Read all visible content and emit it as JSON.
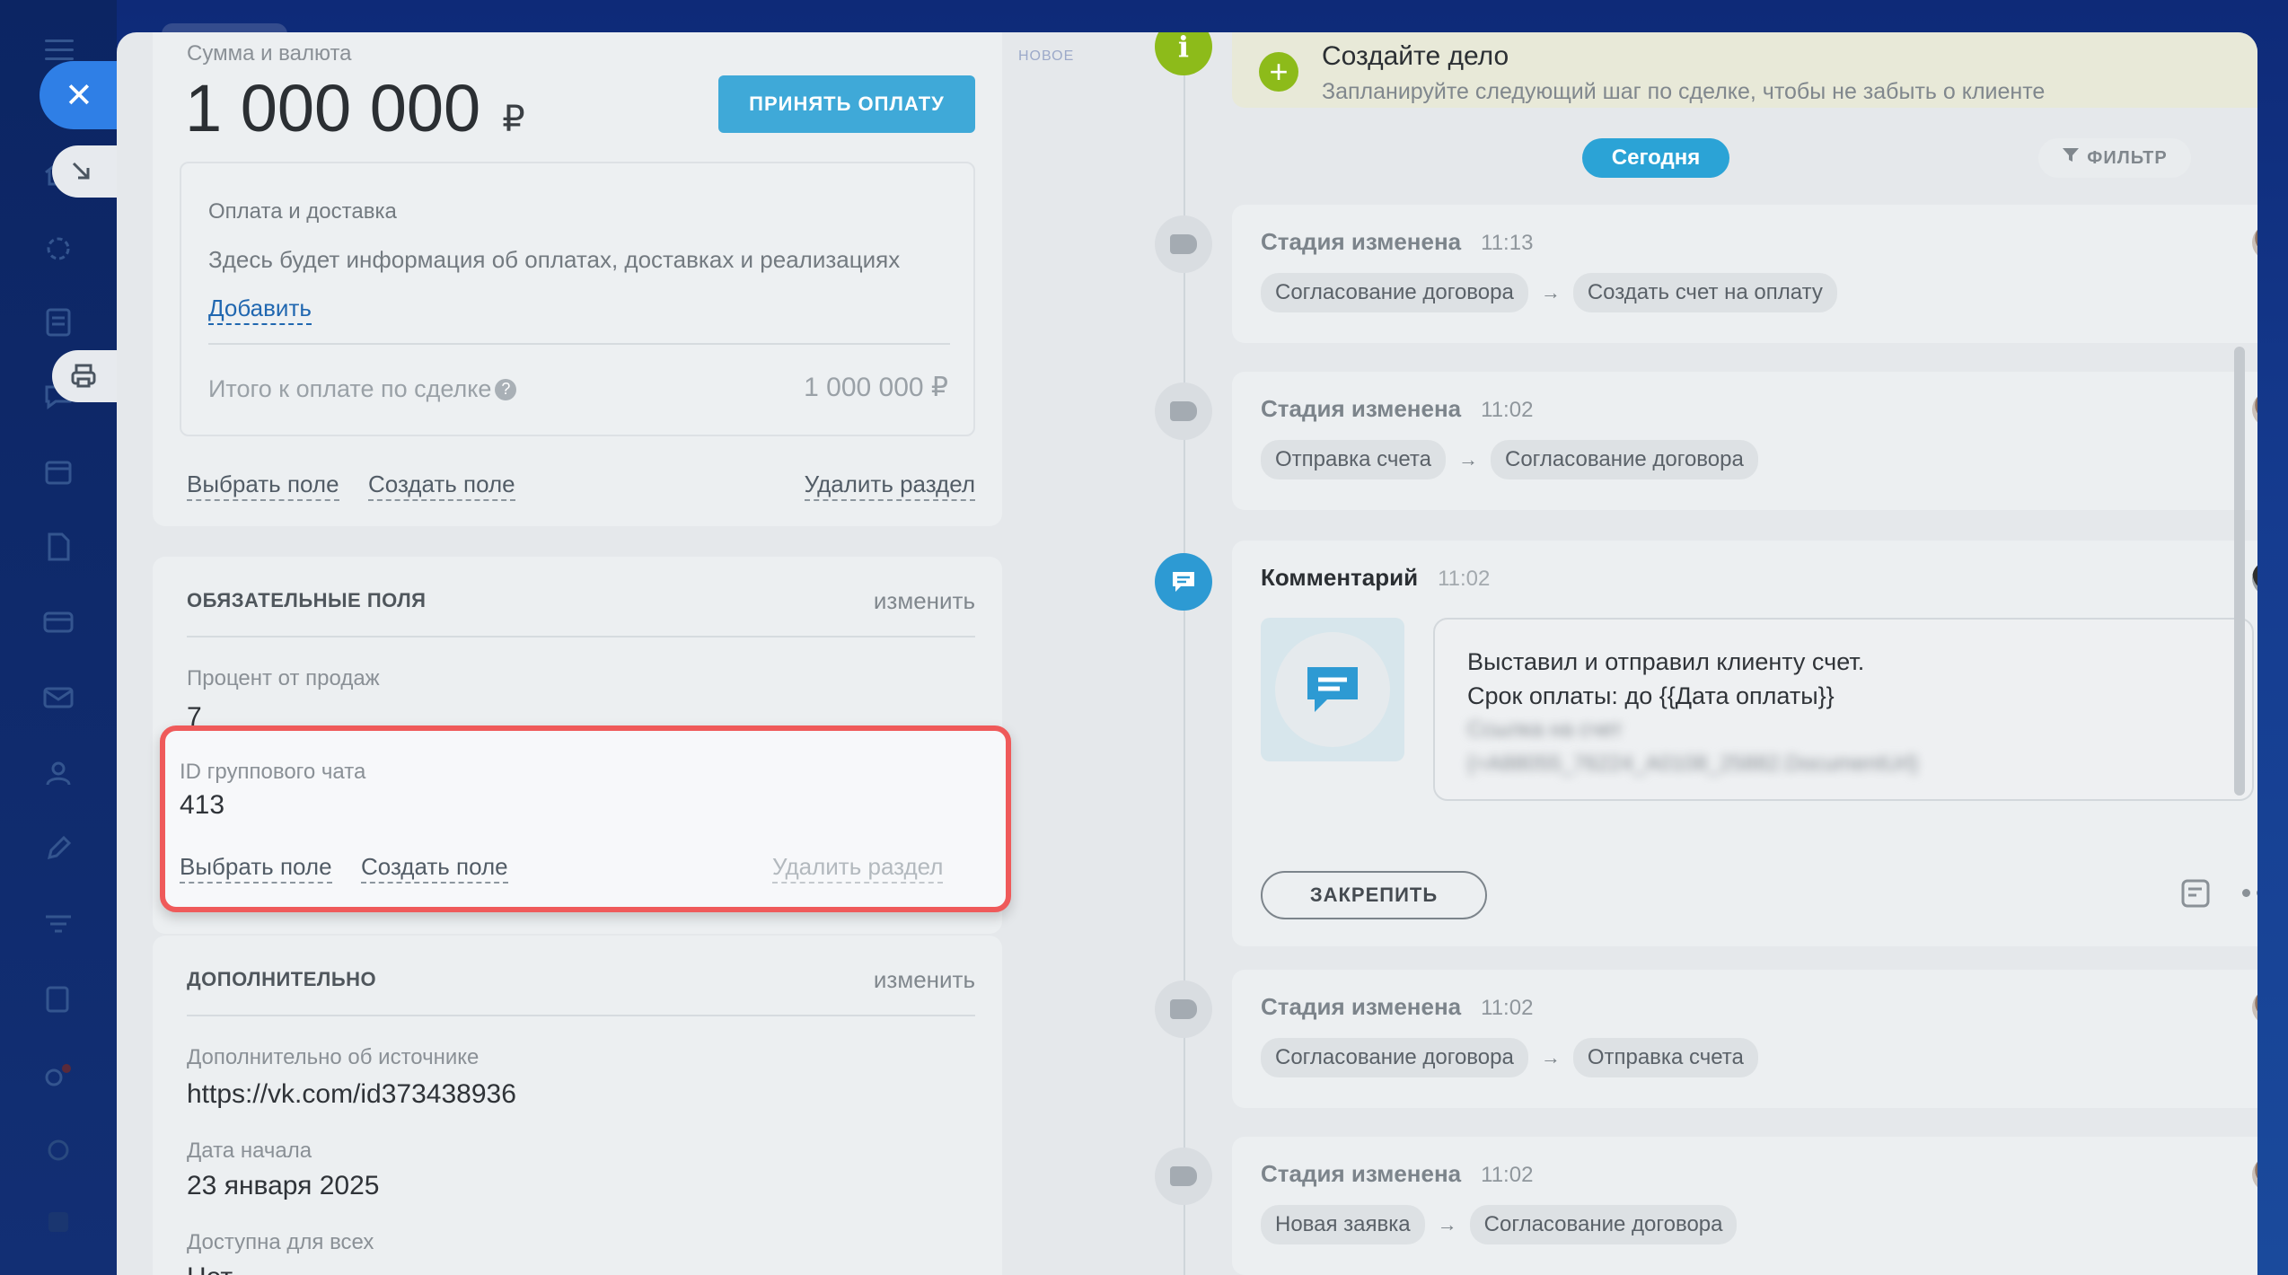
{
  "header": {
    "new_label": "НОВОЕ"
  },
  "payment": {
    "amount_label": "Сумма и валюта",
    "amount": "1 000 000",
    "currency": "₽",
    "accept_button": "ПРИНЯТЬ ОПЛАТУ",
    "delivery_title": "Оплата и доставка",
    "delivery_hint": "Здесь будет информация об оплатах, доставках и реализациях",
    "add_link": "Добавить",
    "total_label": "Итого к оплате по сделке",
    "total_value": "1 000 000 ₽",
    "select_field": "Выбрать поле",
    "create_field": "Создать поле",
    "delete_section": "Удалить раздел"
  },
  "required": {
    "title": "ОБЯЗАТЕЛЬНЫЕ ПОЛЯ",
    "edit": "изменить",
    "sales_percent_label": "Процент от продаж",
    "sales_percent_value": "7"
  },
  "group_chat": {
    "label": "ID группового чата",
    "value": "413",
    "select_field": "Выбрать поле",
    "create_field": "Создать поле",
    "delete_section": "Удалить раздел"
  },
  "additional": {
    "title": "ДОПОЛНИТЕЛЬНО",
    "edit": "изменить",
    "source_label": "Дополнительно об источнике",
    "source_value": "https://vk.com/id373438936",
    "start_label": "Дата начала",
    "start_value": "23 января 2025",
    "access_label": "Доступна для всех",
    "access_value": "Нет"
  },
  "timeline": {
    "todo_title": "Создайте дело",
    "todo_hint": "Запланируйте следующий шаг по сделке, чтобы не забыть о клиенте",
    "today": "Сегодня",
    "filter": "ФИЛЬТР",
    "events": [
      {
        "title": "Стадия изменена",
        "time": "11:13",
        "from": "Согласование договора",
        "to": "Создать счет на оплату"
      },
      {
        "title": "Стадия изменена",
        "time": "11:02",
        "from": "Отправка счета",
        "to": "Согласование договора"
      },
      {
        "title": "Стадия изменена",
        "time": "11:02",
        "from": "Согласование договора",
        "to": "Отправка счета"
      },
      {
        "title": "Стадия изменена",
        "time": "11:02",
        "from": "Новая заявка",
        "to": "Согласование договора"
      }
    ],
    "comment": {
      "title": "Комментарий",
      "time": "11:02",
      "line1": "Выставил и отправил клиенту счет.",
      "line2": "Срок оплаты: до {{Дата оплаты}}",
      "line3": "Ссылка на счет",
      "line4": "{=A88055_76224_A0108_25882.DocumentUrl}",
      "pin_button": "ЗАКРЕПИТЬ"
    }
  },
  "icons": {
    "close": "close-icon",
    "info": "info-icon",
    "plus": "plus-icon",
    "filter": "filter-icon",
    "comment": "comment-icon",
    "more": "more-icon",
    "note": "note-icon"
  },
  "colors": {
    "accent": "#3fa9d8",
    "today_badge": "#2ba3d6",
    "highlight_border": "#ef5a5a",
    "info_green": "#8dbb1a"
  }
}
